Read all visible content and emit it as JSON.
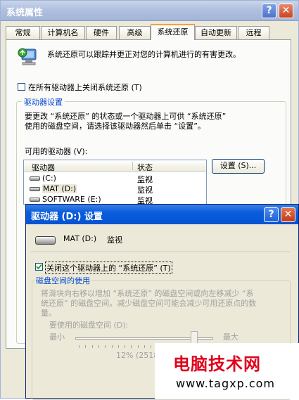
{
  "main": {
    "title": "系统属性",
    "tabs": [
      "常规",
      "计算机名",
      "硬件",
      "高级",
      "系统还原",
      "自动更新",
      "远程"
    ],
    "active_tab": "系统还原",
    "description": "系统还原可以跟踪并更正对您的计算机进行的有害更改。",
    "disable_all_label": "在所有驱动器上关闭系统还原 (T)",
    "drive_settings_group": "驱动器设置",
    "drive_settings_text_1": "要更改 “系统还原” 的状态或一个驱动器上可供 “系统还原”",
    "drive_settings_text_2": "使用的磁盘空间，请选择该驱动器然后单击 “设置”。",
    "available_drives_label": "可用的驱动器 (V):",
    "columns": [
      "驱动器",
      "状态"
    ],
    "drives": [
      {
        "name": "(C:)",
        "status": "监视"
      },
      {
        "name": "MAT (D:)",
        "status": "监视"
      },
      {
        "name": "SOFTWARE (E:)",
        "status": "监视"
      }
    ],
    "settings_button": "设置 (S)..."
  },
  "dialog": {
    "title": "驱动器 (D:) 设置",
    "drive_name": "MAT (D:)",
    "drive_status": "监视",
    "disable_label": "关闭这个驱动器上的 “系统还原” (T)",
    "disk_usage_group": "磁盘空间的使用",
    "usage_text_1": "将滑块向右移以增加 “系统还原” 的磁盘空间或向左移减少 “系",
    "usage_text_2": "统还原” 的磁盘空间。减少磁盘空间可能会减少可用还原点的数",
    "usage_text_3": "量。",
    "space_label": "要使用的磁盘空间 (D):",
    "min_label": "最小",
    "max_label": "最大",
    "slider_value_text": "12% (2518",
    "slider_fraction": 0.88
  },
  "watermark": {
    "title": "电脑技术网",
    "url": "www.tagxp.com"
  },
  "colors": {
    "title_inactive": "#b0c0df",
    "title_active": "#0a5ddc",
    "group_title": "#0046d5",
    "watermark_red": "#e0001b"
  }
}
